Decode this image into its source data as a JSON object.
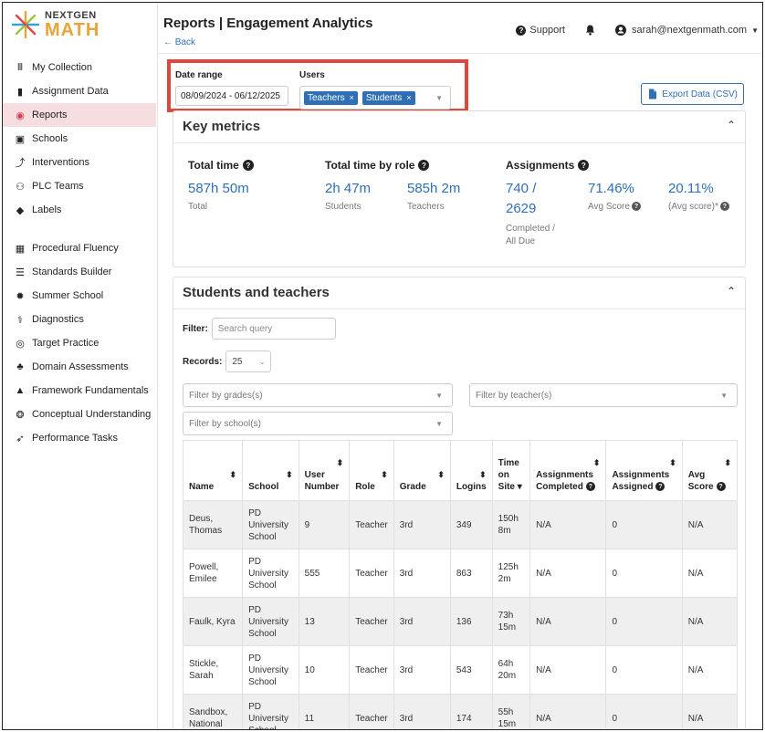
{
  "brand": {
    "line1": "NEXTGEN",
    "line2": "MATH"
  },
  "sidebar": {
    "items": [
      {
        "label": "My Collection",
        "icon": "books-icon",
        "glyph": "𝍫"
      },
      {
        "label": "Assignment Data",
        "icon": "bar-chart-icon",
        "glyph": "▮"
      },
      {
        "label": "Reports",
        "icon": "magnifier-icon",
        "glyph": "◉",
        "active": true
      },
      {
        "label": "Schools",
        "icon": "school-icon",
        "glyph": "▣"
      },
      {
        "label": "Interventions",
        "icon": "route-icon",
        "glyph": "⤴"
      },
      {
        "label": "PLC Teams",
        "icon": "team-icon",
        "glyph": "⚇"
      },
      {
        "label": "Labels",
        "icon": "tag-icon",
        "glyph": "◆"
      },
      {
        "label": "Procedural Fluency",
        "icon": "grid-icon",
        "glyph": "▦"
      },
      {
        "label": "Standards Builder",
        "icon": "list-icon",
        "glyph": "☰"
      },
      {
        "label": "Summer School",
        "icon": "sun-icon",
        "glyph": "✹"
      },
      {
        "label": "Diagnostics",
        "icon": "stethoscope-icon",
        "glyph": "⚕"
      },
      {
        "label": "Target Practice",
        "icon": "target-icon",
        "glyph": "◎"
      },
      {
        "label": "Domain Assessments",
        "icon": "shapes-icon",
        "glyph": "♣"
      },
      {
        "label": "Framework Fundamentals",
        "icon": "pyramid-icon",
        "glyph": "▲"
      },
      {
        "label": "Conceptual Understanding",
        "icon": "brain-icon",
        "glyph": "❂"
      },
      {
        "label": "Performance Tasks",
        "icon": "rocket-icon",
        "glyph": "➶"
      }
    ]
  },
  "header": {
    "title": "Reports | Engagement Analytics",
    "back": "← Back",
    "support": "Support",
    "user": "sarah@nextgenmath.com"
  },
  "filters": {
    "date_label": "Date range",
    "date_value": "08/09/2024 - 06/12/2025",
    "users_label": "Users",
    "chips": [
      "Teachers",
      "Students"
    ]
  },
  "export_label": "Export Data (CSV)",
  "key_metrics": {
    "title": "Key metrics",
    "total_time_label": "Total time",
    "total_time_value": "587h 50m",
    "total_time_sub": "Total",
    "by_role_label": "Total time by role",
    "students_value": "2h 47m",
    "students_sub": "Students",
    "teachers_value": "585h 2m",
    "teachers_sub": "Teachers",
    "assignments_label": "Assignments",
    "assign_value_1": "740 /",
    "assign_value_2": "2629",
    "assign_sub_1": "Completed /",
    "assign_sub_2": "All Due",
    "avg_score_value": "71.46%",
    "avg_score_sub": "Avg Score",
    "avg_score2_value": "20.11%",
    "avg_score2_sub": "(Avg score)*"
  },
  "students_teachers": {
    "title": "Students and teachers",
    "filter_label": "Filter:",
    "filter_placeholder": "Search query",
    "records_label": "Records:",
    "records_value": "25",
    "grades_placeholder": "Filter by grades(s)",
    "teacher_placeholder": "Filter by teacher(s)",
    "school_placeholder": "Filter by school(s)",
    "columns": [
      "Name",
      "School",
      "User Number",
      "Role",
      "Grade",
      "Logins",
      "Time on Site",
      "Assignments Completed",
      "Assignments Assigned",
      "Avg Score"
    ],
    "rows": [
      [
        "Deus, Thomas",
        "PD University School",
        "9",
        "Teacher",
        "3rd",
        "349",
        "150h 8m",
        "N/A",
        "0",
        "N/A"
      ],
      [
        "Powell, Emilee",
        "PD University School",
        "555",
        "Teacher",
        "3rd",
        "863",
        "125h 2m",
        "N/A",
        "0",
        "N/A"
      ],
      [
        "Faulk, Kyra",
        "PD University School",
        "13",
        "Teacher",
        "3rd",
        "136",
        "73h 15m",
        "N/A",
        "0",
        "N/A"
      ],
      [
        "Stickle, Sarah",
        "PD University School",
        "10",
        "Teacher",
        "3rd",
        "543",
        "64h 20m",
        "N/A",
        "0",
        "N/A"
      ],
      [
        "Sandbox, National",
        "PD University School",
        "11",
        "Teacher",
        "3rd",
        "174",
        "55h 15m",
        "N/A",
        "0",
        "N/A"
      ]
    ]
  }
}
